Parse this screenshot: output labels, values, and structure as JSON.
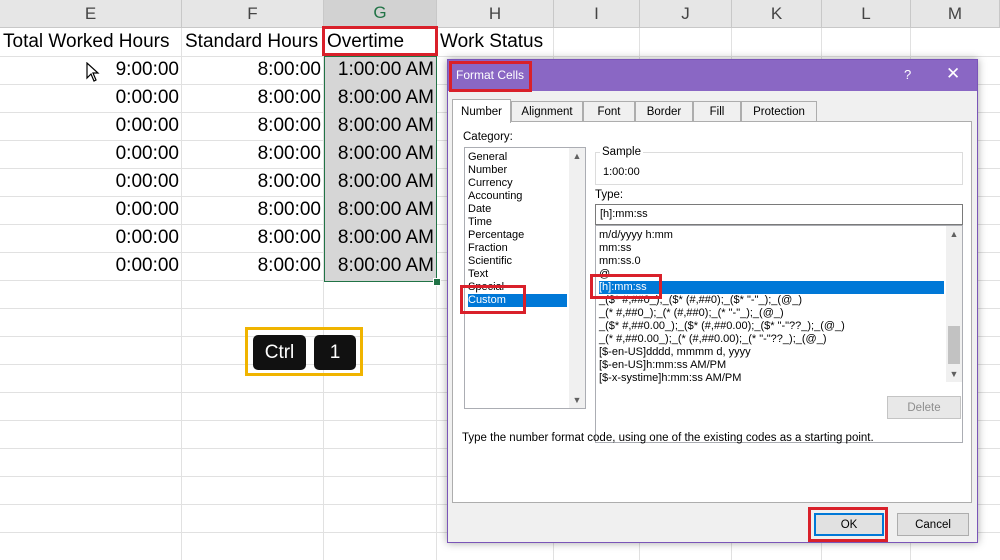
{
  "colors": {
    "accent_green": "#217346",
    "highlight_red": "#d9202a",
    "highlight_yellow": "#f0b400",
    "dialog_purple": "#8a67c4",
    "selection_blue": "#0078d7"
  },
  "sheet": {
    "columns": [
      "E",
      "F",
      "G",
      "H",
      "I",
      "J",
      "K",
      "L",
      "M"
    ],
    "headers": {
      "e": "Total Worked Hours",
      "f": "Standard Hours",
      "g": "Overtime",
      "h": "Work Status"
    },
    "rows": [
      {
        "e": "9:00:00",
        "f": "8:00:00",
        "g": "1:00:00 AM"
      },
      {
        "e": "0:00:00",
        "f": "8:00:00",
        "g": "8:00:00 AM"
      },
      {
        "e": "0:00:00",
        "f": "8:00:00",
        "g": "8:00:00 AM"
      },
      {
        "e": "0:00:00",
        "f": "8:00:00",
        "g": "8:00:00 AM"
      },
      {
        "e": "0:00:00",
        "f": "8:00:00",
        "g": "8:00:00 AM"
      },
      {
        "e": "0:00:00",
        "f": "8:00:00",
        "g": "8:00:00 AM"
      },
      {
        "e": "0:00:00",
        "f": "8:00:00",
        "g": "8:00:00 AM"
      },
      {
        "e": "0:00:00",
        "f": "8:00:00",
        "g": "8:00:00 AM"
      }
    ],
    "shortcut": {
      "key1": "Ctrl",
      "key2": "1"
    }
  },
  "dialog": {
    "title": "Format Cells",
    "help": "?",
    "close": "✕",
    "tabs": [
      "Number",
      "Alignment",
      "Font",
      "Border",
      "Fill",
      "Protection"
    ],
    "category_label": "Category:",
    "categories": [
      "General",
      "Number",
      "Currency",
      "Accounting",
      "Date",
      "Time",
      "Percentage",
      "Fraction",
      "Scientific",
      "Text",
      "Special",
      "Custom"
    ],
    "selected_category": "Custom",
    "sample_label": "Sample",
    "sample_value": "1:00:00",
    "type_label": "Type:",
    "type_value": "[h]:mm:ss",
    "type_list": [
      "m/d/yyyy h:mm",
      "mm:ss",
      "mm:ss.0",
      "@",
      "[h]:mm:ss",
      "_($* #,##0_);_($* (#,##0);_($* \"-\"_);_(@_)",
      "_(* #,##0_);_(* (#,##0);_(* \"-\"_);_(@_)",
      "_($* #,##0.00_);_($* (#,##0.00);_($* \"-\"??_);_(@_)",
      "_(* #,##0.00_);_(* (#,##0.00);_(* \"-\"??_);_(@_)",
      "[$-en-US]dddd, mmmm d, yyyy",
      "[$-en-US]h:mm:ss AM/PM",
      "[$-x-systime]h:mm:ss AM/PM"
    ],
    "selected_type": "[h]:mm:ss",
    "delete_label": "Delete",
    "description": "Type the number format code, using one of the existing codes as a starting point.",
    "ok_label": "OK",
    "cancel_label": "Cancel"
  }
}
